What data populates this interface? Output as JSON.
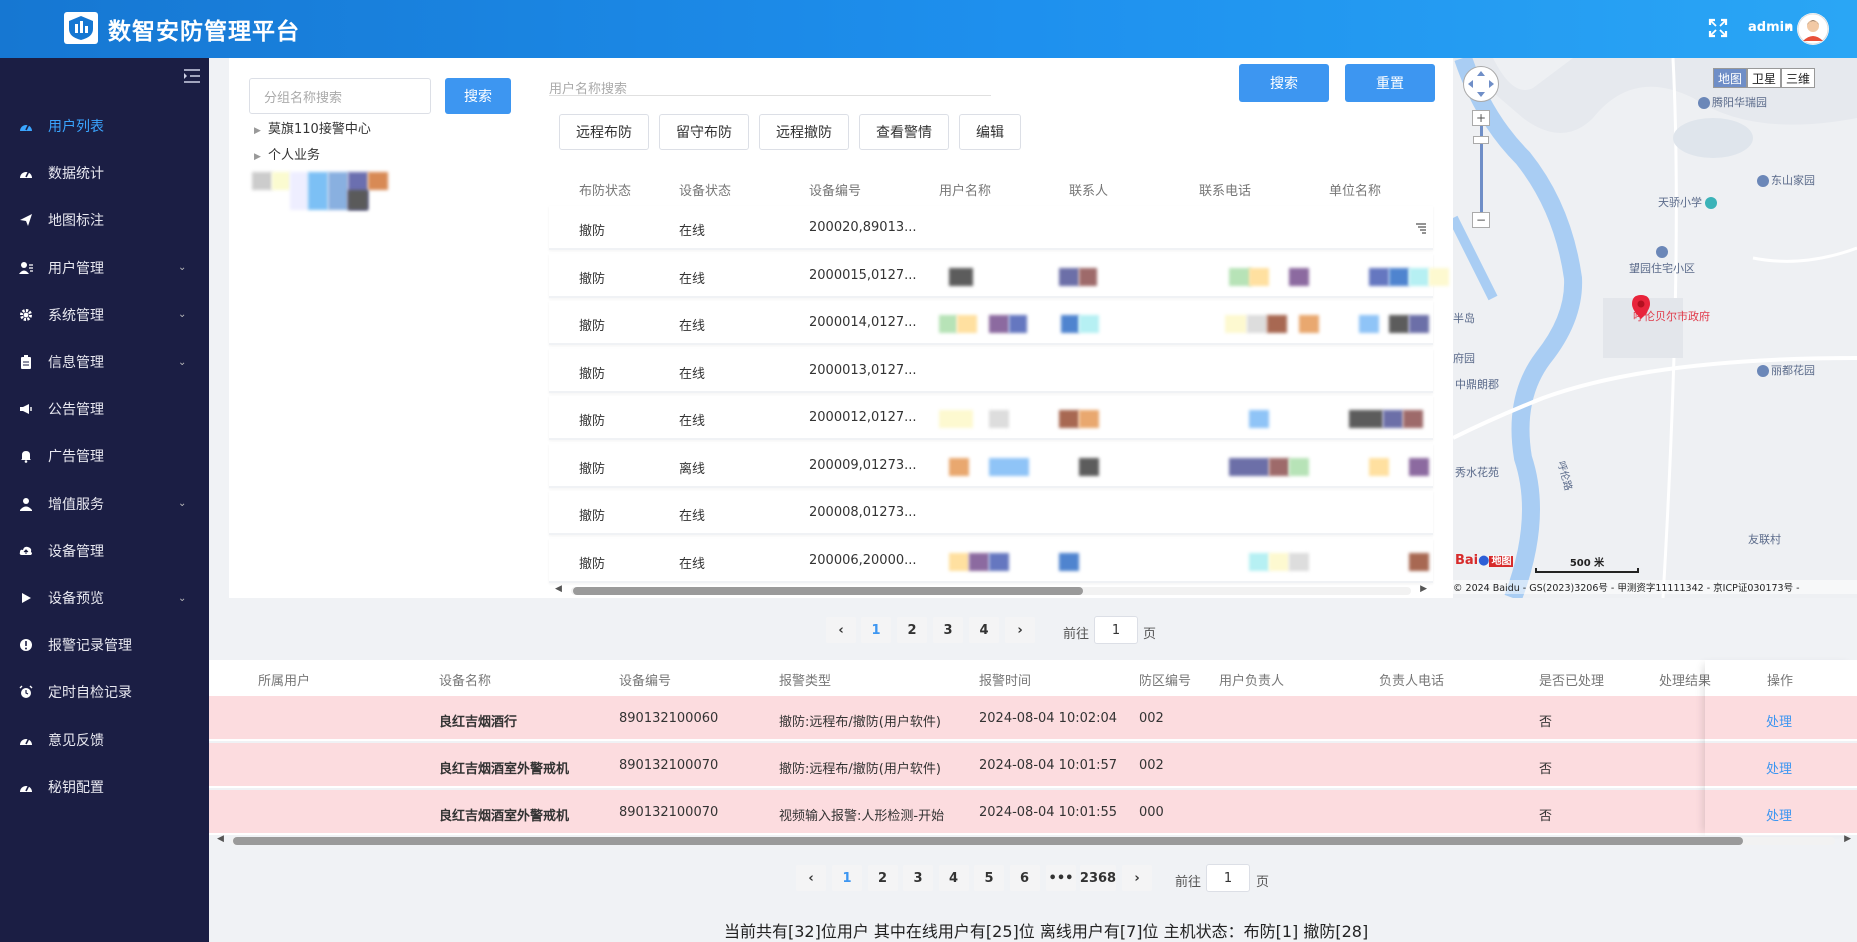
{
  "header": {
    "title": "数智安防管理平台",
    "user": "admin",
    "caret": "▾"
  },
  "sidebar": {
    "items": [
      {
        "label": "用户列表",
        "icon": "dashboard-icon",
        "active": true
      },
      {
        "label": "数据统计",
        "icon": "dashboard-icon"
      },
      {
        "label": "地图标注",
        "icon": "paper-plane-icon"
      },
      {
        "label": "用户管理",
        "icon": "user-group-icon",
        "expandable": true
      },
      {
        "label": "系统管理",
        "icon": "gear-icon",
        "expandable": true
      },
      {
        "label": "信息管理",
        "icon": "clipboard-icon",
        "expandable": true
      },
      {
        "label": "公告管理",
        "icon": "megaphone-icon"
      },
      {
        "label": "广告管理",
        "icon": "bell-icon"
      },
      {
        "label": "增值服务",
        "icon": "person-icon",
        "expandable": true
      },
      {
        "label": "设备管理",
        "icon": "cloud-icon"
      },
      {
        "label": "设备预览",
        "icon": "play-icon",
        "expandable": true
      },
      {
        "label": "报警记录管理",
        "icon": "alert-icon"
      },
      {
        "label": "定时自检记录",
        "icon": "alarm-clock-icon"
      },
      {
        "label": "意见反馈",
        "icon": "dashboard-icon"
      },
      {
        "label": "秘钥配置",
        "icon": "dashboard-icon"
      }
    ]
  },
  "left": {
    "search_placeholder": "分组名称搜索",
    "search_button": "搜索",
    "tree": [
      "莫旗110接警中心",
      "个人业务"
    ]
  },
  "mid": {
    "search_placeholder": "用户名称搜索",
    "search_button": "搜索",
    "reset_button": "重置",
    "actions": [
      "远程布防",
      "留守布防",
      "远程撤防",
      "查看警情",
      "编辑"
    ],
    "columns": [
      "布防状态",
      "设备状态",
      "设备编号",
      "用户名称",
      "联系人",
      "联系电话",
      "单位名称"
    ],
    "rows": [
      {
        "arm": "撤防",
        "status": "在线",
        "id": "200020,89013..."
      },
      {
        "arm": "撤防",
        "status": "在线",
        "id": "2000015,0127..."
      },
      {
        "arm": "撤防",
        "status": "在线",
        "id": "2000014,0127..."
      },
      {
        "arm": "撤防",
        "status": "在线",
        "id": "2000013,0127..."
      },
      {
        "arm": "撤防",
        "status": "在线",
        "id": "2000012,0127..."
      },
      {
        "arm": "撤防",
        "status": "离线",
        "id": "200009,01273..."
      },
      {
        "arm": "撤防",
        "status": "在线",
        "id": "200008,01273..."
      },
      {
        "arm": "撤防",
        "status": "在线",
        "id": "200006,20000..."
      }
    ],
    "pager": {
      "prev": "‹",
      "next": "›",
      "pages": [
        "1",
        "2",
        "3",
        "4"
      ],
      "goto_prefix": "前往",
      "goto_value": "1",
      "goto_suffix": "页"
    }
  },
  "map": {
    "types": [
      "地图",
      "卫星",
      "三维"
    ],
    "zoom_in": "+",
    "zoom_out": "−",
    "pois": [
      "腾阳华瑞园",
      "东山家园",
      "天骄小学",
      "望园住宅小区",
      "呼伦贝尔市政府",
      "丽都花园",
      "半岛",
      "府园",
      "中鼎朗郡",
      "秀水花苑",
      "友联村"
    ],
    "road_label": "呼伦路",
    "scale": "500 米",
    "logo_text": "Bai",
    "logo_suffix": "地图",
    "copyright": "© 2024 Baidu - GS(2023)3206号 - 甲测资字11111342 - 京ICP证030173号 -"
  },
  "alarms": {
    "columns": [
      "所属用户",
      "设备名称",
      "设备编号",
      "报警类型",
      "报警时间",
      "防区编号",
      "用户负责人",
      "负责人电话",
      "是否已处理",
      "处理结果",
      "操作"
    ],
    "rows": [
      {
        "device": "良红吉烟酒行",
        "id": "890132100060",
        "type": "撤防:远程布/撤防(用户软件)",
        "time": "2024-08-04 10:02:04",
        "zone": "002",
        "handled": "否",
        "op": "处理"
      },
      {
        "device": "良红吉烟酒室外警戒机",
        "id": "890132100070",
        "type": "撤防:远程布/撤防(用户软件)",
        "time": "2024-08-04 10:01:57",
        "zone": "002",
        "handled": "否",
        "op": "处理"
      },
      {
        "device": "良红吉烟酒室外警戒机",
        "id": "890132100070",
        "type": "视频输入报警:人形检测-开始",
        "time": "2024-08-04 10:01:55",
        "zone": "000",
        "handled": "否",
        "op": "处理"
      }
    ],
    "pager": {
      "prev": "‹",
      "next": "›",
      "pages": [
        "1",
        "2",
        "3",
        "4",
        "5",
        "6"
      ],
      "ellipsis": "•••",
      "last": "2368",
      "goto_prefix": "前往",
      "goto_value": "1",
      "goto_suffix": "页"
    }
  },
  "footer": {
    "stats": "当前共有[32]位用户 其中在线用户有[25]位 离线用户有[7]位 主机状态：布防[1] 撤防[28]"
  },
  "colors": {
    "header_start": "#1677d2",
    "sidebar_bg": "#1b1e44",
    "accent": "#3d96f1",
    "alarm_row": "#fcdcdf"
  }
}
